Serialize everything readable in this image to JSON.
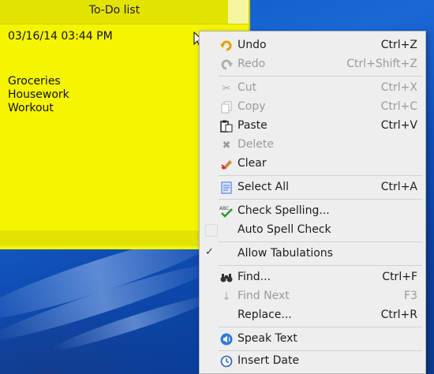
{
  "note": {
    "title": "To-Do list",
    "date": "03/16/14 03:44 PM",
    "items": [
      "Groceries",
      "Housework",
      "Workout"
    ]
  },
  "colors": {
    "note_yellow": "#f5f500",
    "menu_bg": "#eeeeee",
    "desktop_blue": "#0b57c7"
  },
  "menu": {
    "undo": {
      "label": "Undo",
      "shortcut": "Ctrl+Z",
      "icon": "undo-icon"
    },
    "redo": {
      "label": "Redo",
      "shortcut": "Ctrl+Shift+Z",
      "icon": "redo-icon"
    },
    "cut": {
      "label": "Cut",
      "shortcut": "Ctrl+X",
      "icon": "scissors-icon"
    },
    "copy": {
      "label": "Copy",
      "shortcut": "Ctrl+C",
      "icon": "copy-icon"
    },
    "paste": {
      "label": "Paste",
      "shortcut": "Ctrl+V",
      "icon": "clipboard-icon"
    },
    "delete": {
      "label": "Delete",
      "icon": "delete-x-icon"
    },
    "clear": {
      "label": "Clear",
      "icon": "eraser-icon"
    },
    "select_all": {
      "label": "Select All",
      "shortcut": "Ctrl+A",
      "icon": "document-icon"
    },
    "check_spelling": {
      "label": "Check Spelling...",
      "icon": "spellcheck-icon"
    },
    "auto_spell_check": {
      "label": "Auto Spell Check",
      "checked": false
    },
    "allow_tabulations": {
      "label": "Allow Tabulations",
      "checked": true
    },
    "find": {
      "label": "Find...",
      "shortcut": "Ctrl+F",
      "icon": "binoculars-icon"
    },
    "find_next": {
      "label": "Find Next",
      "shortcut": "F3",
      "icon": "arrow-down-icon"
    },
    "replace": {
      "label": "Replace...",
      "shortcut": "Ctrl+R"
    },
    "speak_text": {
      "label": "Speak Text",
      "icon": "speaker-icon"
    },
    "insert_date": {
      "label": "Insert Date",
      "icon": "clock-icon"
    }
  }
}
